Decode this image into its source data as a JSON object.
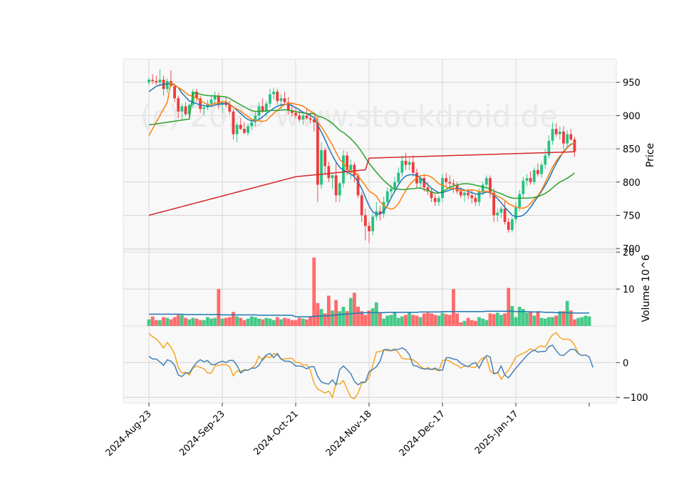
{
  "chart_data": {
    "type": "candlestick",
    "watermark": "(c) 2025 www.stockdroid.de",
    "x_tick_labels": [
      "2024-Aug-23",
      "2024-Sep-23",
      "2024-Oct-21",
      "2024-Nov-18",
      "2024-Dec-17",
      "2025-Jan-17"
    ],
    "x_tick_index": [
      0,
      20,
      40,
      60,
      80,
      100
    ],
    "price_panel": {
      "ylabel": "Price",
      "ylim": [
        698,
        985
      ],
      "yticks": [
        700,
        750,
        800,
        850,
        900,
        950
      ],
      "candles": [
        [
          950,
          958,
          946,
          954
        ],
        [
          954,
          962,
          948,
          952
        ],
        [
          952,
          960,
          946,
          950
        ],
        [
          950,
          970,
          944,
          954
        ],
        [
          954,
          960,
          930,
          940
        ],
        [
          940,
          956,
          934,
          952
        ],
        [
          952,
          968,
          944,
          944
        ],
        [
          944,
          948,
          920,
          926
        ],
        [
          926,
          930,
          896,
          906
        ],
        [
          906,
          918,
          894,
          914
        ],
        [
          914,
          920,
          900,
          902
        ],
        [
          902,
          918,
          898,
          916
        ],
        [
          916,
          940,
          912,
          936
        ],
        [
          936,
          940,
          920,
          926
        ],
        [
          926,
          930,
          904,
          910
        ],
        [
          910,
          916,
          900,
          912
        ],
        [
          912,
          924,
          908,
          918
        ],
        [
          918,
          930,
          912,
          924
        ],
        [
          924,
          936,
          916,
          930
        ],
        [
          930,
          934,
          910,
          916
        ],
        [
          916,
          924,
          904,
          920
        ],
        [
          920,
          928,
          912,
          916
        ],
        [
          916,
          922,
          902,
          906
        ],
        [
          906,
          910,
          864,
          872
        ],
        [
          872,
          890,
          860,
          886
        ],
        [
          886,
          896,
          878,
          880
        ],
        [
          880,
          890,
          872,
          874
        ],
        [
          874,
          888,
          870,
          884
        ],
        [
          884,
          896,
          878,
          890
        ],
        [
          890,
          906,
          884,
          900
        ],
        [
          900,
          920,
          894,
          914
        ],
        [
          914,
          926,
          904,
          906
        ],
        [
          906,
          922,
          898,
          918
        ],
        [
          918,
          940,
          912,
          932
        ],
        [
          932,
          942,
          924,
          936
        ],
        [
          936,
          940,
          916,
          922
        ],
        [
          922,
          932,
          910,
          926
        ],
        [
          926,
          936,
          916,
          920
        ],
        [
          920,
          928,
          902,
          908
        ],
        [
          908,
          920,
          898,
          904
        ],
        [
          904,
          912,
          896,
          900
        ],
        [
          900,
          908,
          890,
          894
        ],
        [
          894,
          902,
          886,
          900
        ],
        [
          900,
          910,
          894,
          896
        ],
        [
          896,
          904,
          888,
          894
        ],
        [
          894,
          898,
          876,
          890
        ],
        [
          890,
          900,
          770,
          796
        ],
        [
          796,
          860,
          790,
          848
        ],
        [
          848,
          852,
          810,
          824
        ],
        [
          824,
          830,
          800,
          806
        ],
        [
          806,
          812,
          790,
          810
        ],
        [
          810,
          830,
          770,
          780
        ],
        [
          780,
          800,
          770,
          798
        ],
        [
          798,
          848,
          792,
          840
        ],
        [
          840,
          846,
          810,
          818
        ],
        [
          818,
          834,
          804,
          826
        ],
        [
          826,
          830,
          800,
          810
        ],
        [
          810,
          814,
          776,
          780
        ],
        [
          780,
          784,
          740,
          750
        ],
        [
          750,
          760,
          712,
          734
        ],
        [
          734,
          740,
          708,
          726
        ],
        [
          726,
          752,
          720,
          748
        ],
        [
          748,
          770,
          742,
          756
        ],
        [
          756,
          764,
          742,
          752
        ],
        [
          752,
          778,
          746,
          770
        ],
        [
          770,
          792,
          764,
          786
        ],
        [
          786,
          796,
          776,
          790
        ],
        [
          790,
          808,
          784,
          800
        ],
        [
          800,
          822,
          796,
          814
        ],
        [
          814,
          840,
          808,
          832
        ],
        [
          832,
          844,
          818,
          826
        ],
        [
          826,
          836,
          818,
          830
        ],
        [
          830,
          840,
          808,
          814
        ],
        [
          814,
          820,
          790,
          798
        ],
        [
          798,
          810,
          790,
          806
        ],
        [
          806,
          812,
          786,
          792
        ],
        [
          792,
          800,
          780,
          786
        ],
        [
          786,
          790,
          770,
          776
        ],
        [
          776,
          782,
          764,
          770
        ],
        [
          770,
          780,
          764,
          776
        ],
        [
          776,
          812,
          770,
          806
        ],
        [
          806,
          814,
          794,
          800
        ],
        [
          800,
          810,
          790,
          798
        ],
        [
          798,
          804,
          784,
          796
        ],
        [
          796,
          800,
          782,
          786
        ],
        [
          786,
          792,
          776,
          780
        ],
        [
          780,
          786,
          770,
          784
        ],
        [
          784,
          790,
          774,
          780
        ],
        [
          780,
          788,
          768,
          776
        ],
        [
          776,
          780,
          764,
          770
        ],
        [
          770,
          790,
          764,
          786
        ],
        [
          786,
          800,
          780,
          796
        ],
        [
          796,
          810,
          792,
          806
        ],
        [
          806,
          810,
          776,
          784
        ],
        [
          784,
          790,
          740,
          750
        ],
        [
          750,
          760,
          740,
          754
        ],
        [
          754,
          764,
          746,
          760
        ],
        [
          760,
          772,
          736,
          740
        ],
        [
          740,
          746,
          724,
          728
        ],
        [
          728,
          748,
          724,
          744
        ],
        [
          744,
          770,
          738,
          762
        ],
        [
          762,
          788,
          756,
          782
        ],
        [
          782,
          808,
          776,
          802
        ],
        [
          802,
          812,
          794,
          806
        ],
        [
          806,
          816,
          796,
          800
        ],
        [
          800,
          822,
          796,
          818
        ],
        [
          818,
          828,
          808,
          812
        ],
        [
          812,
          830,
          806,
          826
        ],
        [
          826,
          850,
          820,
          840
        ],
        [
          840,
          870,
          836,
          862
        ],
        [
          862,
          890,
          856,
          880
        ],
        [
          880,
          888,
          868,
          872
        ],
        [
          872,
          884,
          864,
          876
        ],
        [
          876,
          884,
          850,
          858
        ],
        [
          858,
          878,
          852,
          872
        ],
        [
          872,
          880,
          862,
          864
        ],
        [
          864,
          868,
          838,
          846
        ]
      ],
      "ma_short_name": "MA blue",
      "ma_short": [
        936,
        940,
        944,
        946,
        947,
        948,
        948,
        946,
        942,
        934,
        928,
        922,
        920,
        918,
        916,
        915,
        914,
        914,
        916,
        917,
        918,
        918,
        917,
        913,
        908,
        903,
        898,
        894,
        892,
        892,
        894,
        898,
        903,
        907,
        911,
        914,
        916,
        917,
        917,
        915,
        912,
        909,
        905,
        903,
        900,
        897,
        886,
        875,
        864,
        851,
        840,
        830,
        822,
        818,
        815,
        812,
        808,
        800,
        790,
        777,
        764,
        755,
        752,
        752,
        756,
        765,
        776,
        786,
        796,
        804,
        809,
        811,
        811,
        810,
        806,
        801,
        796,
        791,
        787,
        784,
        784,
        786,
        788,
        790,
        791,
        790,
        788,
        786,
        784,
        782,
        782,
        783,
        785,
        784,
        780,
        775,
        769,
        762,
        756,
        750,
        748,
        748,
        750,
        755,
        762,
        770,
        778,
        786,
        795,
        805,
        817,
        828,
        837,
        846,
        852,
        857,
        858
      ]
    },
    "volume_panel": {
      "ylabel": "Volume  10^6",
      "ylim": [
        0,
        20.6
      ],
      "yticks": [
        10,
        20
      ],
      "values": [
        1.8,
        2.6,
        1.6,
        1.6,
        2.4,
        2.2,
        1.8,
        2.4,
        3,
        3,
        2.2,
        1.8,
        2.2,
        2,
        1.6,
        1.6,
        2.4,
        2,
        2.2,
        10,
        2,
        2.2,
        2.4,
        3.8,
        2.6,
        2.2,
        1.6,
        2,
        2.6,
        2.4,
        2,
        1.8,
        2.2,
        2,
        1.6,
        2.4,
        1.8,
        2.2,
        2,
        1.6,
        1.6,
        2.2,
        2,
        1.8,
        2.4,
        18.5,
        6.2,
        4.6,
        3.4,
        8.2,
        4.2,
        7,
        4,
        5.2,
        4,
        7.6,
        9,
        5.2,
        4,
        3,
        4.2,
        4.8,
        6.4,
        3.6,
        2,
        2.8,
        3,
        3.6,
        2.2,
        2.6,
        3,
        3.6,
        3,
        2.8,
        2.4,
        3.4,
        3.6,
        3.4,
        3,
        2.8,
        3.6,
        3.2,
        3,
        10,
        3.4,
        1,
        1.4,
        2.2,
        1.6,
        1.4,
        2.4,
        2,
        1.6,
        3.4,
        3.2,
        3.6,
        3,
        3.4,
        10.3,
        5.4,
        2.4,
        5.2,
        4.6,
        3.6,
        4,
        2.8,
        4,
        2.2,
        2,
        2.4,
        2.4,
        2.8,
        4,
        4,
        6.8,
        4.2,
        1.8,
        2.2,
        2.4,
        2.8,
        2.6
      ],
      "avg": [
        3.2,
        3.2,
        3.2,
        3.2,
        3.2,
        3.2,
        3.2,
        3.2,
        3.2,
        3.2,
        3.1,
        3.1,
        3.1,
        3.1,
        3.1,
        3.1,
        3.1,
        3.1,
        3.1,
        3.1,
        3,
        3,
        3,
        3,
        3,
        3,
        3,
        3,
        3,
        3,
        2.9,
        2.9,
        2.9,
        2.9,
        2.9,
        2.9,
        2.9,
        2.9,
        2.9,
        2.9,
        2.5,
        2.5,
        2.5,
        2.5,
        2.5,
        2.6,
        2.7,
        2.7,
        2.8,
        2.8,
        2.9,
        3,
        3.1,
        3.2,
        3.2,
        3.3,
        3.4,
        3.5,
        3.5,
        3.6,
        3.6,
        3.6,
        3.6,
        3.6,
        3.6,
        3.7,
        3.7,
        3.7,
        3.7,
        3.7,
        3.7,
        3.7,
        3.7,
        3.7,
        3.8,
        3.8,
        3.8,
        3.8,
        3.8,
        3.8,
        3.9,
        3.9,
        3.9,
        3.9,
        3.9,
        3.9,
        3.9,
        3.9,
        3.9,
        3.9,
        3.9,
        3.9,
        4,
        4,
        4,
        4,
        4,
        4,
        4,
        4,
        3.9,
        3.9,
        3.9,
        3.9,
        3.8,
        3.8,
        3.8,
        3.8,
        3.7,
        3.7,
        3.7,
        3.6,
        3.6,
        3.6,
        3.6,
        3.5,
        3.5,
        3.5,
        3.5,
        3.5,
        3.5
      ]
    },
    "oscillator_panel": {
      "ylim": [
        -116,
        105
      ],
      "yticks": [
        -100,
        0
      ],
      "blue_line": [
        18,
        10,
        10,
        2,
        -8,
        8,
        4,
        -8,
        -36,
        -40,
        -30,
        -30,
        -14,
        0,
        8,
        2,
        6,
        -6,
        -6,
        0,
        4,
        0,
        6,
        6,
        -8,
        -30,
        -22,
        -22,
        -16,
        -16,
        -8,
        10,
        22,
        26,
        14,
        26,
        10,
        4,
        4,
        0,
        -10,
        -10,
        -12,
        -18,
        -12,
        -12,
        -40,
        -56,
        -60,
        -62,
        -50,
        -64,
        -20,
        -10,
        -20,
        -32,
        -54,
        -64,
        -56,
        -56,
        -26,
        -20,
        -12,
        4,
        36,
        38,
        34,
        36,
        38,
        42,
        36,
        22,
        -8,
        -10,
        -16,
        -18,
        -18,
        -20,
        -16,
        -22,
        -22,
        14,
        14,
        10,
        8,
        -2,
        -8,
        -12,
        -4,
        0,
        -16,
        6,
        20,
        16,
        -32,
        -30,
        -10,
        -36,
        -44,
        -30,
        -16,
        -4,
        8,
        20,
        30,
        36,
        30,
        32,
        32,
        46,
        50,
        34,
        22,
        20,
        30,
        38,
        38,
        26,
        20,
        22,
        16,
        -14
      ],
      "orange_line": [
        84,
        74,
        68,
        56,
        42,
        58,
        44,
        24,
        -14,
        -30,
        -28,
        -36,
        -16,
        -10,
        -14,
        -18,
        -30,
        -30,
        -10,
        -8,
        -6,
        -6,
        -12,
        -38,
        -24,
        -26,
        -20,
        -22,
        -16,
        -6,
        18,
        6,
        18,
        14,
        26,
        22,
        10,
        10,
        12,
        12,
        0,
        0,
        -8,
        -6,
        -22,
        -60,
        -76,
        -82,
        -88,
        -82,
        -100,
        -60,
        -62,
        -52,
        -76,
        -100,
        -104,
        -88,
        -60,
        -56,
        -44,
        -8,
        30,
        32,
        36,
        34,
        34,
        40,
        28,
        12,
        10,
        10,
        8,
        0,
        -10,
        -20,
        -14,
        -20,
        -20,
        -24,
        6,
        8,
        4,
        -4,
        -8,
        -16,
        -10,
        -10,
        -14,
        -14,
        4,
        14,
        14,
        -24,
        -32,
        -28,
        -48,
        -34,
        -22,
        -4,
        16,
        22,
        26,
        32,
        40,
        34,
        44,
        48,
        44,
        64,
        80,
        86,
        72,
        66,
        68,
        64,
        50,
        28
      ]
    }
  }
}
